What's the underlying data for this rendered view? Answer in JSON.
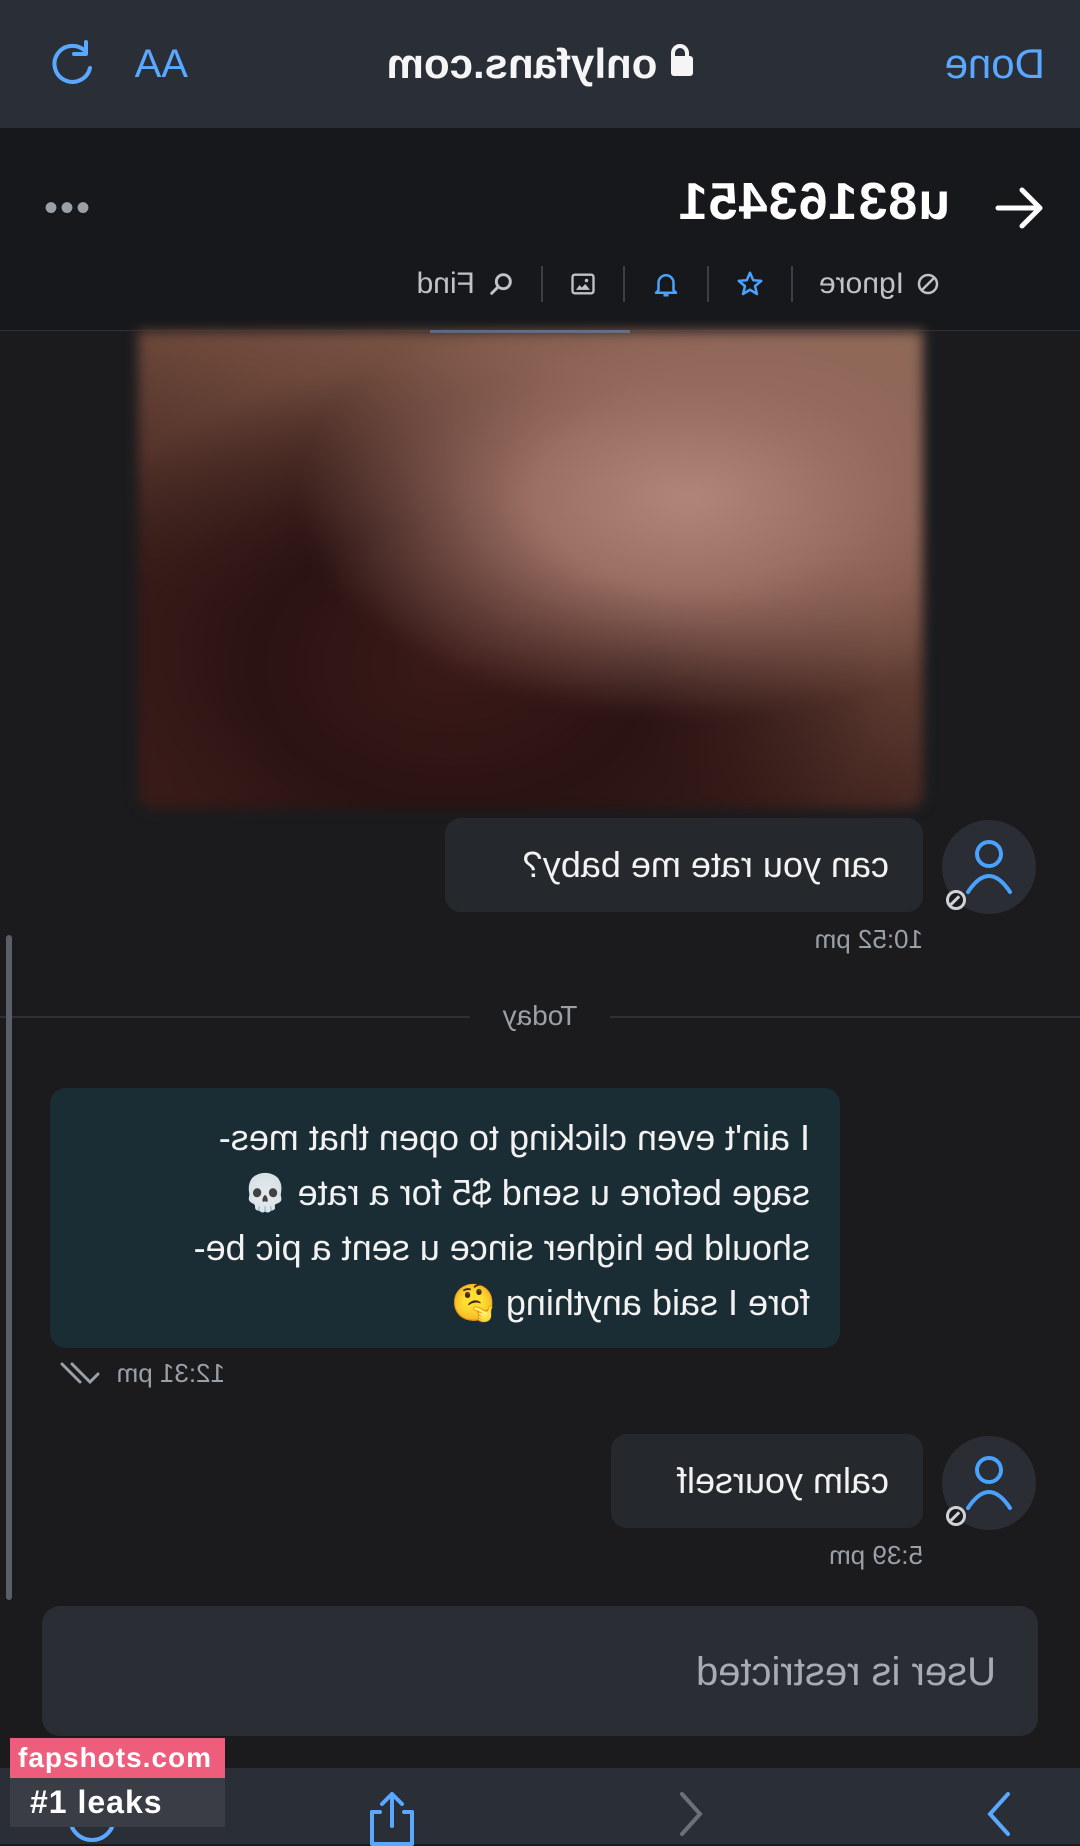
{
  "browser": {
    "done_label": "Done",
    "url": "onlyfans.com",
    "text_size_label": "AA"
  },
  "chat": {
    "username": "u83163451",
    "actions": [
      {
        "label": "Ignore",
        "icon": "block-icon"
      },
      {
        "label": "",
        "icon": "star-icon"
      },
      {
        "label": "",
        "icon": "bell-icon"
      },
      {
        "label": "",
        "icon": "image-icon"
      },
      {
        "label": "Find",
        "icon": "search-icon"
      }
    ],
    "accent": "#4aa2ff"
  },
  "messages": [
    {
      "side": "incoming",
      "text": "can you rate me baby?",
      "time": "10:52 pm"
    },
    {
      "side": "outgoing",
      "lines": [
        "I ain't even clicking to open that mes-",
        "sage before u send $5 for a rate 💀",
        "should be higher since u sent a pic be-",
        "fore I said anything 🤔"
      ],
      "time": "12:31 pm"
    },
    {
      "side": "incoming",
      "text": "calm yourself",
      "time": "5:39 pm"
    }
  ],
  "day_divider": "Today",
  "footer": {
    "restricted_text": "User is restricted"
  },
  "watermark": {
    "site": "fapshots.com",
    "tagline": "#1 leaks"
  }
}
